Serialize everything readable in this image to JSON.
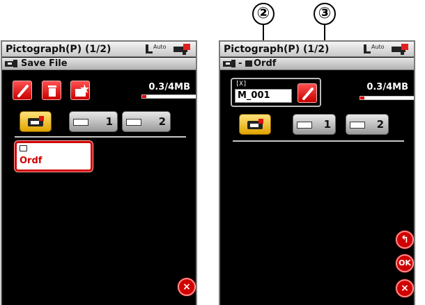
{
  "callouts": [
    "②",
    "③"
  ],
  "left_screen": {
    "title": "Pictograph(P) (1/2)",
    "auto_label": "Auto",
    "subtitle": "Save File",
    "capacity": "0.3/4MB",
    "capacity_fill": 0.075,
    "tabs": [
      "1",
      "2"
    ],
    "folder_name": "Ordf",
    "close_symbol": "×"
  },
  "right_screen": {
    "title": "Pictograph(P) (1/2)",
    "auto_label": "Auto",
    "path_dash": "-",
    "path_folder": "Ordf",
    "capacity": "0.3/4MB",
    "capacity_fill": 0.075,
    "hoop_glyph": "[X]",
    "file_name": "M_001",
    "tabs": [
      "1",
      "2"
    ],
    "back_symbol": "↰",
    "ok_label": "OK",
    "close_symbol": "×"
  },
  "icons": {
    "rename": "pencil-icon",
    "delete": "trash-icon",
    "new_folder": "new-folder-icon",
    "usb": "usb-icon",
    "machine": "sewing-machine-icon"
  },
  "colors": {
    "accent_red": "#d00000",
    "selected_tab": "#f0c030",
    "screen_bg": "#000000"
  }
}
